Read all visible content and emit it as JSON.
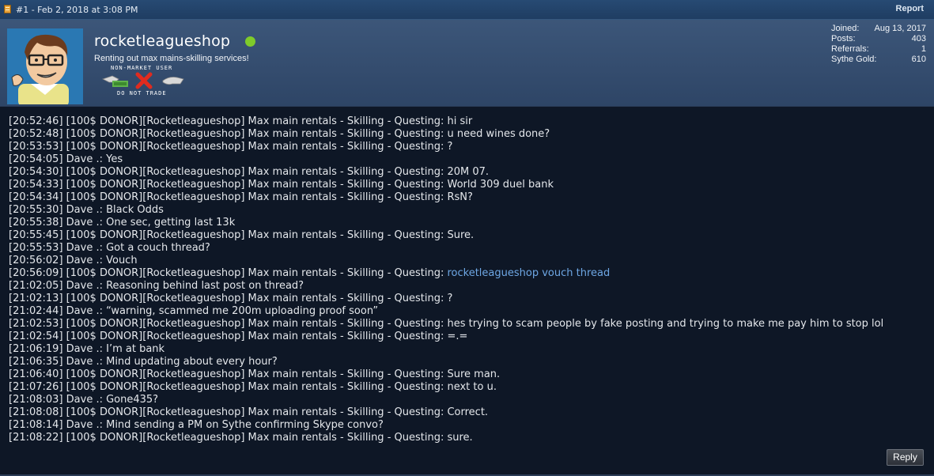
{
  "post": {
    "meta": "#1 - Feb 2, 2018 at 3:08 PM",
    "report_label": "Report"
  },
  "user": {
    "username": "rocketleagueshop",
    "title": "Renting out max mains-skilling services!",
    "badge_top": "NON-MARKET USER",
    "badge_bottom": "DO NOT TRADE",
    "online_color": "#7fcb2a"
  },
  "stats": [
    {
      "label": "Joined:",
      "value": "Aug 13, 2017"
    },
    {
      "label": "Posts:",
      "value": "403"
    },
    {
      "label": "Referrals:",
      "value": "1"
    },
    {
      "label": "Sythe Gold:",
      "value": "610"
    }
  ],
  "chat": [
    {
      "text": "[20:52:46] [100$ DONOR][Rocketleagueshop] Max main rentals - Skilling - Questing: hi sir"
    },
    {
      "text": "[20:52:48] [100$ DONOR][Rocketleagueshop] Max main rentals - Skilling - Questing: u need wines done?"
    },
    {
      "text": "[20:53:53] [100$ DONOR][Rocketleagueshop] Max main rentals - Skilling - Questing: ?"
    },
    {
      "text": "[20:54:05] Dave .: Yes"
    },
    {
      "text": "[20:54:30] [100$ DONOR][Rocketleagueshop] Max main rentals - Skilling - Questing: 20M 07."
    },
    {
      "text": "[20:54:33] [100$ DONOR][Rocketleagueshop] Max main rentals - Skilling - Questing: World 309 duel bank"
    },
    {
      "text": "[20:54:34] [100$ DONOR][Rocketleagueshop] Max main rentals - Skilling - Questing: RsN?"
    },
    {
      "text": "[20:55:30] Dave .: Black Odds"
    },
    {
      "text": "[20:55:38] Dave .: One sec, getting last 13k"
    },
    {
      "text": "[20:55:45] [100$ DONOR][Rocketleagueshop] Max main rentals - Skilling - Questing: Sure."
    },
    {
      "text": "[20:55:53] Dave .: Got a couch thread?"
    },
    {
      "text": "[20:56:02] Dave .: Vouch"
    },
    {
      "text": "[20:56:09] [100$ DONOR][Rocketleagueshop] Max main rentals - Skilling - Questing: ",
      "link": "rocketleagueshop vouch thread"
    },
    {
      "text": "[21:02:05] Dave .: Reasoning behind last post on thread?"
    },
    {
      "text": "[21:02:13] [100$ DONOR][Rocketleagueshop] Max main rentals - Skilling - Questing: ?"
    },
    {
      "text": "[21:02:44] Dave .: “warning, scammed me 200m uploading proof soon”"
    },
    {
      "text": "[21:02:53] [100$ DONOR][Rocketleagueshop] Max main rentals - Skilling - Questing: hes trying to scam people by fake posting and trying to make me pay him to stop lol"
    },
    {
      "text": "[21:02:54] [100$ DONOR][Rocketleagueshop] Max main rentals - Skilling - Questing: =.="
    },
    {
      "text": "[21:06:19] Dave .: I’m at bank"
    },
    {
      "text": "[21:06:35] Dave .: Mind updating about every hour?"
    },
    {
      "text": "[21:06:40] [100$ DONOR][Rocketleagueshop] Max main rentals - Skilling - Questing: Sure man."
    },
    {
      "text": "[21:07:26] [100$ DONOR][Rocketleagueshop] Max main rentals - Skilling - Questing: next to u."
    },
    {
      "text": "[21:08:03] Dave .: Gone435?"
    },
    {
      "text": "[21:08:08] [100$ DONOR][Rocketleagueshop] Max main rentals - Skilling - Questing: Correct."
    },
    {
      "text": "[21:08:14] Dave .: Mind sending a PM on Sythe confirming Skype convo?"
    },
    {
      "text": "[21:08:22] [100$ DONOR][Rocketleagueshop] Max main rentals - Skilling - Questing: sure."
    }
  ],
  "reply_label": "Reply"
}
